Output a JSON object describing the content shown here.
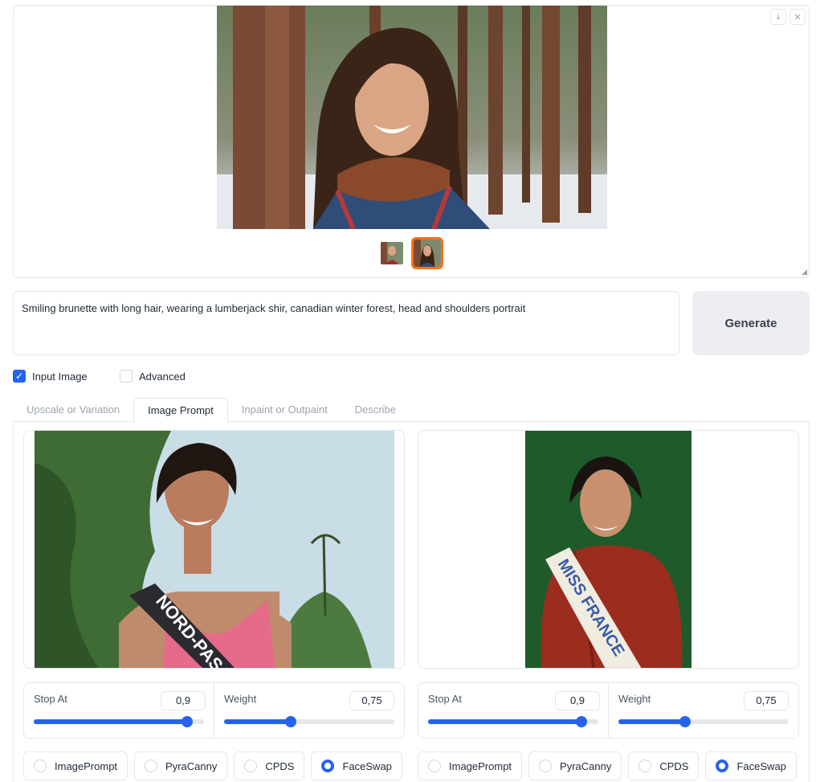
{
  "gallery": {
    "download_icon": "download-icon",
    "close_icon": "close-icon",
    "thumbnails": [
      "thumb-1",
      "thumb-2"
    ],
    "selected_thumb": 2
  },
  "prompt": {
    "text": "Smiling brunette with long hair, wearing a lumberjack shir, canadian winter forest, head and shoulders portrait"
  },
  "generate_label": "Generate",
  "options": {
    "input_image": {
      "label": "Input Image",
      "checked": true
    },
    "advanced": {
      "label": "Advanced",
      "checked": false
    }
  },
  "tabs": [
    {
      "label": "Upscale or Variation",
      "active": false
    },
    {
      "label": "Image Prompt",
      "active": true
    },
    {
      "label": "Inpaint or Outpaint",
      "active": false
    },
    {
      "label": "Describe",
      "active": false
    }
  ],
  "image_prompts": [
    {
      "stop_at": {
        "label": "Stop At",
        "value": "0,9",
        "fraction": 0.9
      },
      "weight": {
        "label": "Weight",
        "value": "0,75",
        "fraction": 0.39
      },
      "sash_text": "NORD-PAS",
      "types": [
        "ImagePrompt",
        "PyraCanny",
        "CPDS",
        "FaceSwap"
      ],
      "selected_type": "FaceSwap"
    },
    {
      "stop_at": {
        "label": "Stop At",
        "value": "0,9",
        "fraction": 0.9
      },
      "weight": {
        "label": "Weight",
        "value": "0,75",
        "fraction": 0.39
      },
      "sash_text": "MISS FRANCE",
      "types": [
        "ImagePrompt",
        "PyraCanny",
        "CPDS",
        "FaceSwap"
      ],
      "selected_type": "FaceSwap"
    }
  ],
  "colors": {
    "accent": "#2563eb",
    "selected_thumb_border": "#f97316",
    "generate_bg": "#eceef1"
  }
}
